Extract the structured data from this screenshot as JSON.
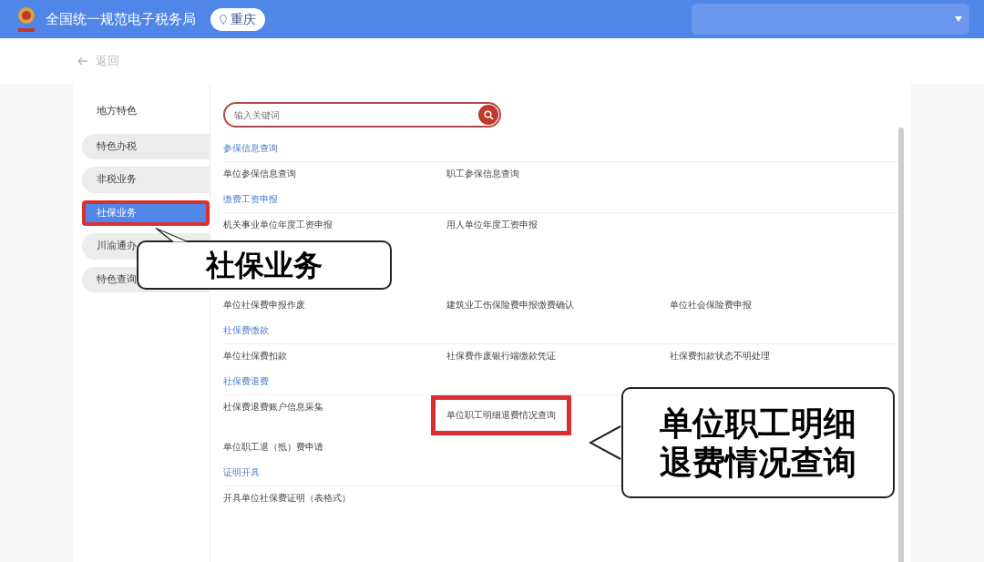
{
  "header": {
    "title": "全国统一规范电子税务局",
    "region": "重庆"
  },
  "back_link": "返回",
  "sidebar": {
    "title": "地方特色",
    "items": [
      {
        "label": "特色办税",
        "selected": false,
        "highlighted": false
      },
      {
        "label": "非税业务",
        "selected": false,
        "highlighted": false
      },
      {
        "label": "社保业务",
        "selected": true,
        "highlighted": true
      },
      {
        "label": "川渝通办",
        "selected": false,
        "highlighted": false
      },
      {
        "label": "特色查询",
        "selected": false,
        "highlighted": false
      }
    ]
  },
  "search": {
    "placeholder": "输入关键词"
  },
  "sections": [
    {
      "title": "参保信息查询",
      "rows": [
        [
          {
            "label": "单位参保信息查询",
            "highlighted": false
          },
          {
            "label": "职工参保信息查询",
            "highlighted": false
          }
        ]
      ]
    },
    {
      "title": "缴费工资申报",
      "rows": [
        [
          {
            "label": "机关事业单位年度工资申报",
            "highlighted": false
          },
          {
            "label": "用人单位年度工资申报",
            "highlighted": false
          }
        ],
        [
          {
            "label": "单位社保费申报作废",
            "highlighted": false
          },
          {
            "label": "建筑业工伤保险费申报缴费确认",
            "highlighted": false
          },
          {
            "label": "单位社会保险费申报",
            "highlighted": false
          }
        ]
      ]
    },
    {
      "title": "社保费缴款",
      "rows": [
        [
          {
            "label": "单位社保费扣款",
            "highlighted": false
          },
          {
            "label": "社保费作废银行端缴款凭证",
            "highlighted": false
          },
          {
            "label": "社保费扣款状态不明处理",
            "highlighted": false
          }
        ]
      ]
    },
    {
      "title": "社保费退费",
      "rows": [
        [
          {
            "label": "社保费退费账户信息采集",
            "highlighted": false
          },
          {
            "label": "单位职工明细退费情况查询",
            "highlighted": true
          }
        ],
        [
          {
            "label": "单位职工退（抵）费申请",
            "highlighted": false
          }
        ]
      ]
    },
    {
      "title": "证明开具",
      "rows": [
        [
          {
            "label": "开具单位社保费证明（表格式）",
            "highlighted": false
          }
        ]
      ]
    }
  ],
  "callouts": [
    {
      "lines": [
        "社保业务"
      ]
    },
    {
      "lines": [
        "单位职工明细",
        "退费情况查询"
      ]
    }
  ]
}
